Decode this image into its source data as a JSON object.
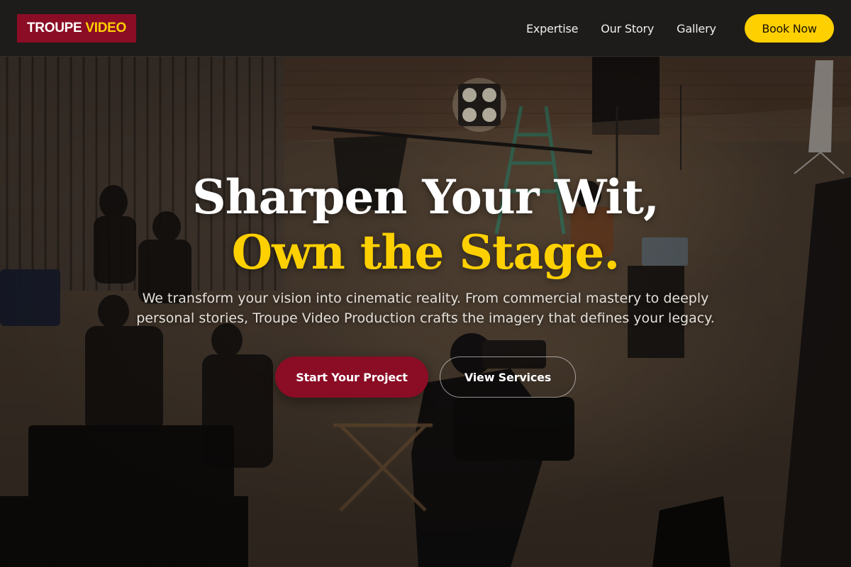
{
  "brand": {
    "logo_word1": "TROUPE",
    "logo_word2": "VIDEO",
    "colors": {
      "primary": "#8b0c25",
      "accent": "#ffd000",
      "nav_bg": "#1e1c1b"
    }
  },
  "nav": {
    "links": [
      "Expertise",
      "Our Story",
      "Gallery"
    ],
    "cta_label": "Book Now"
  },
  "hero": {
    "headline_line1": "Sharpen Your Wit,",
    "headline_line2": "Own the Stage.",
    "subtitle_line1": "We transform your vision into cinematic reality. From commercial mastery to deeply",
    "subtitle_line2": "personal stories, Troupe Video Production crafts the imagery that defines your legacy.",
    "primary_cta": "Start Your Project",
    "secondary_cta": "View Services"
  }
}
